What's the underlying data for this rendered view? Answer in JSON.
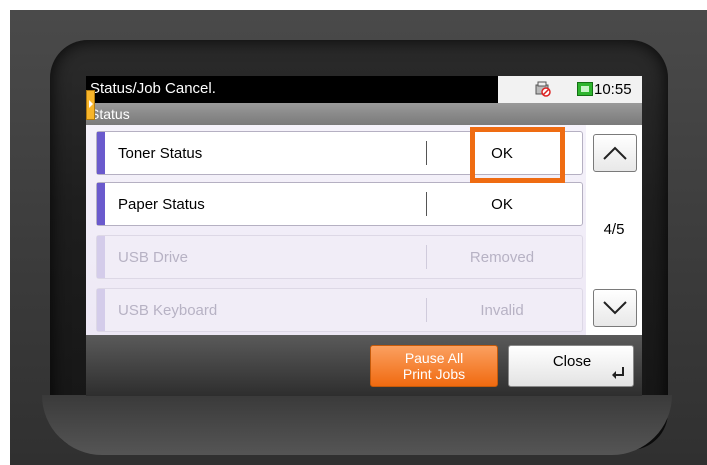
{
  "header": {
    "title": "Status/Job Cancel.",
    "clock": "10:55",
    "icons": {
      "fax": "no-fax-icon",
      "network": "network-status-icon"
    }
  },
  "subheader": {
    "title": "Status"
  },
  "status_rows": [
    {
      "label": "Toner Status",
      "value": "OK",
      "enabled": true
    },
    {
      "label": "Paper Status",
      "value": "OK",
      "enabled": true
    },
    {
      "label": "USB Drive",
      "value": "Removed",
      "enabled": false
    },
    {
      "label": "USB Keyboard",
      "value": "Invalid",
      "enabled": false
    }
  ],
  "pagination": {
    "page": "4/5"
  },
  "footer": {
    "pause_line1": "Pause All",
    "pause_line2": "Print Jobs",
    "close_label": "Close"
  },
  "colors": {
    "accent_orange": "#ef6c12",
    "row_accent": "#6a5acd",
    "header_bg": "#000000"
  }
}
